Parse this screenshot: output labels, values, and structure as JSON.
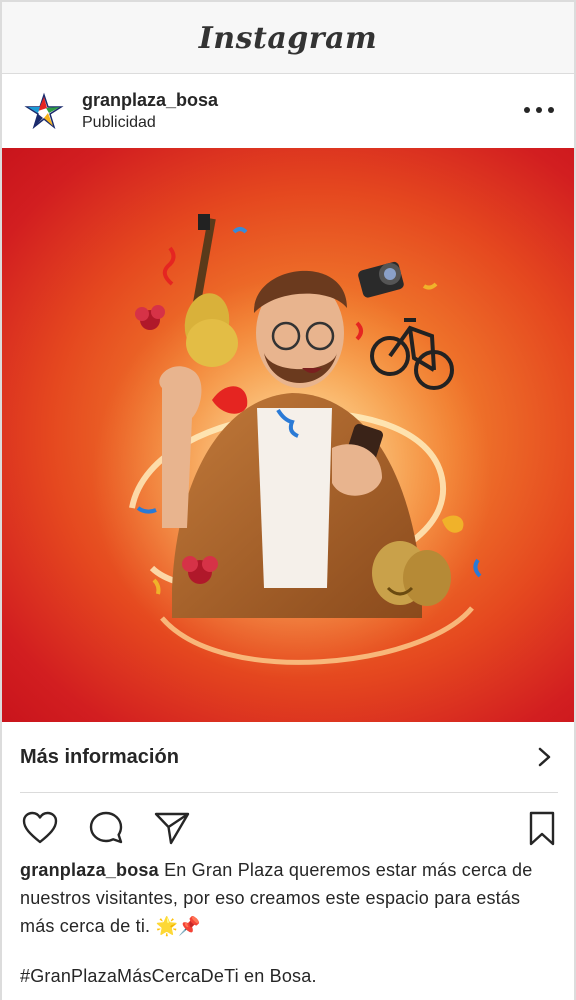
{
  "app": {
    "logo_text": "Instagram"
  },
  "post": {
    "username": "granplaza_bosa",
    "sponsored_label": "Publicidad",
    "cta_label": "Más información",
    "caption_user": "granplaza_bosa",
    "caption_text": "En Gran Plaza queremos estar más cerca de nuestros visitantes, por eso creamos este espacio para estás más cerca de ti. 🌟📌",
    "hashtag_line": "#GranPlazaMásCercaDeTi en Bosa."
  },
  "icons": {
    "more": "more-options-icon",
    "like": "heart-icon",
    "comment": "comment-icon",
    "share": "send-icon",
    "save": "bookmark-icon",
    "cta_arrow": "chevron-right-icon"
  },
  "colors": {
    "image_bg_center": "#f7a24a",
    "image_bg_edge": "#c9141c",
    "text": "#262626",
    "divider": "#dbdbdb"
  }
}
